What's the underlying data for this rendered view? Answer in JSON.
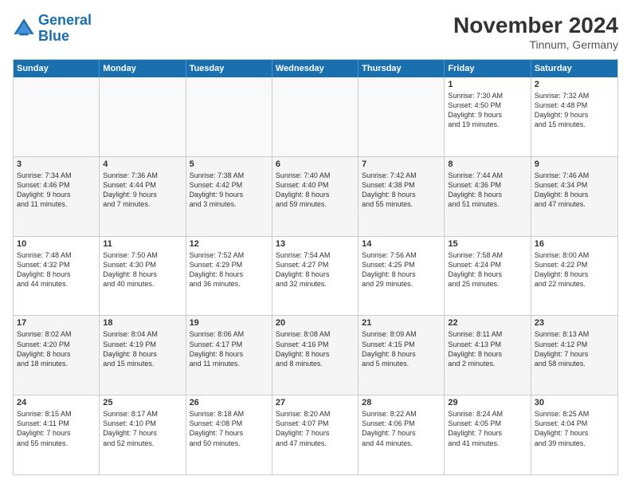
{
  "logo": {
    "line1": "General",
    "line2": "Blue"
  },
  "title": "November 2024",
  "location": "Tinnum, Germany",
  "header_days": [
    "Sunday",
    "Monday",
    "Tuesday",
    "Wednesday",
    "Thursday",
    "Friday",
    "Saturday"
  ],
  "rows": [
    [
      {
        "day": "",
        "text": "",
        "empty": true
      },
      {
        "day": "",
        "text": "",
        "empty": true
      },
      {
        "day": "",
        "text": "",
        "empty": true
      },
      {
        "day": "",
        "text": "",
        "empty": true
      },
      {
        "day": "",
        "text": "",
        "empty": true
      },
      {
        "day": "1",
        "text": "Sunrise: 7:30 AM\nSunset: 4:50 PM\nDaylight: 9 hours\nand 19 minutes.",
        "empty": false
      },
      {
        "day": "2",
        "text": "Sunrise: 7:32 AM\nSunset: 4:48 PM\nDaylight: 9 hours\nand 15 minutes.",
        "empty": false
      }
    ],
    [
      {
        "day": "3",
        "text": "Sunrise: 7:34 AM\nSunset: 4:46 PM\nDaylight: 9 hours\nand 11 minutes.",
        "empty": false
      },
      {
        "day": "4",
        "text": "Sunrise: 7:36 AM\nSunset: 4:44 PM\nDaylight: 9 hours\nand 7 minutes.",
        "empty": false
      },
      {
        "day": "5",
        "text": "Sunrise: 7:38 AM\nSunset: 4:42 PM\nDaylight: 9 hours\nand 3 minutes.",
        "empty": false
      },
      {
        "day": "6",
        "text": "Sunrise: 7:40 AM\nSunset: 4:40 PM\nDaylight: 8 hours\nand 59 minutes.",
        "empty": false
      },
      {
        "day": "7",
        "text": "Sunrise: 7:42 AM\nSunset: 4:38 PM\nDaylight: 8 hours\nand 55 minutes.",
        "empty": false
      },
      {
        "day": "8",
        "text": "Sunrise: 7:44 AM\nSunset: 4:36 PM\nDaylight: 8 hours\nand 51 minutes.",
        "empty": false
      },
      {
        "day": "9",
        "text": "Sunrise: 7:46 AM\nSunset: 4:34 PM\nDaylight: 8 hours\nand 47 minutes.",
        "empty": false
      }
    ],
    [
      {
        "day": "10",
        "text": "Sunrise: 7:48 AM\nSunset: 4:32 PM\nDaylight: 8 hours\nand 44 minutes.",
        "empty": false
      },
      {
        "day": "11",
        "text": "Sunrise: 7:50 AM\nSunset: 4:30 PM\nDaylight: 8 hours\nand 40 minutes.",
        "empty": false
      },
      {
        "day": "12",
        "text": "Sunrise: 7:52 AM\nSunset: 4:29 PM\nDaylight: 8 hours\nand 36 minutes.",
        "empty": false
      },
      {
        "day": "13",
        "text": "Sunrise: 7:54 AM\nSunset: 4:27 PM\nDaylight: 8 hours\nand 32 minutes.",
        "empty": false
      },
      {
        "day": "14",
        "text": "Sunrise: 7:56 AM\nSunset: 4:25 PM\nDaylight: 8 hours\nand 29 minutes.",
        "empty": false
      },
      {
        "day": "15",
        "text": "Sunrise: 7:58 AM\nSunset: 4:24 PM\nDaylight: 8 hours\nand 25 minutes.",
        "empty": false
      },
      {
        "day": "16",
        "text": "Sunrise: 8:00 AM\nSunset: 4:22 PM\nDaylight: 8 hours\nand 22 minutes.",
        "empty": false
      }
    ],
    [
      {
        "day": "17",
        "text": "Sunrise: 8:02 AM\nSunset: 4:20 PM\nDaylight: 8 hours\nand 18 minutes.",
        "empty": false
      },
      {
        "day": "18",
        "text": "Sunrise: 8:04 AM\nSunset: 4:19 PM\nDaylight: 8 hours\nand 15 minutes.",
        "empty": false
      },
      {
        "day": "19",
        "text": "Sunrise: 8:06 AM\nSunset: 4:17 PM\nDaylight: 8 hours\nand 11 minutes.",
        "empty": false
      },
      {
        "day": "20",
        "text": "Sunrise: 8:08 AM\nSunset: 4:16 PM\nDaylight: 8 hours\nand 8 minutes.",
        "empty": false
      },
      {
        "day": "21",
        "text": "Sunrise: 8:09 AM\nSunset: 4:15 PM\nDaylight: 8 hours\nand 5 minutes.",
        "empty": false
      },
      {
        "day": "22",
        "text": "Sunrise: 8:11 AM\nSunset: 4:13 PM\nDaylight: 8 hours\nand 2 minutes.",
        "empty": false
      },
      {
        "day": "23",
        "text": "Sunrise: 8:13 AM\nSunset: 4:12 PM\nDaylight: 7 hours\nand 58 minutes.",
        "empty": false
      }
    ],
    [
      {
        "day": "24",
        "text": "Sunrise: 8:15 AM\nSunset: 4:11 PM\nDaylight: 7 hours\nand 55 minutes.",
        "empty": false
      },
      {
        "day": "25",
        "text": "Sunrise: 8:17 AM\nSunset: 4:10 PM\nDaylight: 7 hours\nand 52 minutes.",
        "empty": false
      },
      {
        "day": "26",
        "text": "Sunrise: 8:18 AM\nSunset: 4:08 PM\nDaylight: 7 hours\nand 50 minutes.",
        "empty": false
      },
      {
        "day": "27",
        "text": "Sunrise: 8:20 AM\nSunset: 4:07 PM\nDaylight: 7 hours\nand 47 minutes.",
        "empty": false
      },
      {
        "day": "28",
        "text": "Sunrise: 8:22 AM\nSunset: 4:06 PM\nDaylight: 7 hours\nand 44 minutes.",
        "empty": false
      },
      {
        "day": "29",
        "text": "Sunrise: 8:24 AM\nSunset: 4:05 PM\nDaylight: 7 hours\nand 41 minutes.",
        "empty": false
      },
      {
        "day": "30",
        "text": "Sunrise: 8:25 AM\nSunset: 4:04 PM\nDaylight: 7 hours\nand 39 minutes.",
        "empty": false
      }
    ]
  ]
}
